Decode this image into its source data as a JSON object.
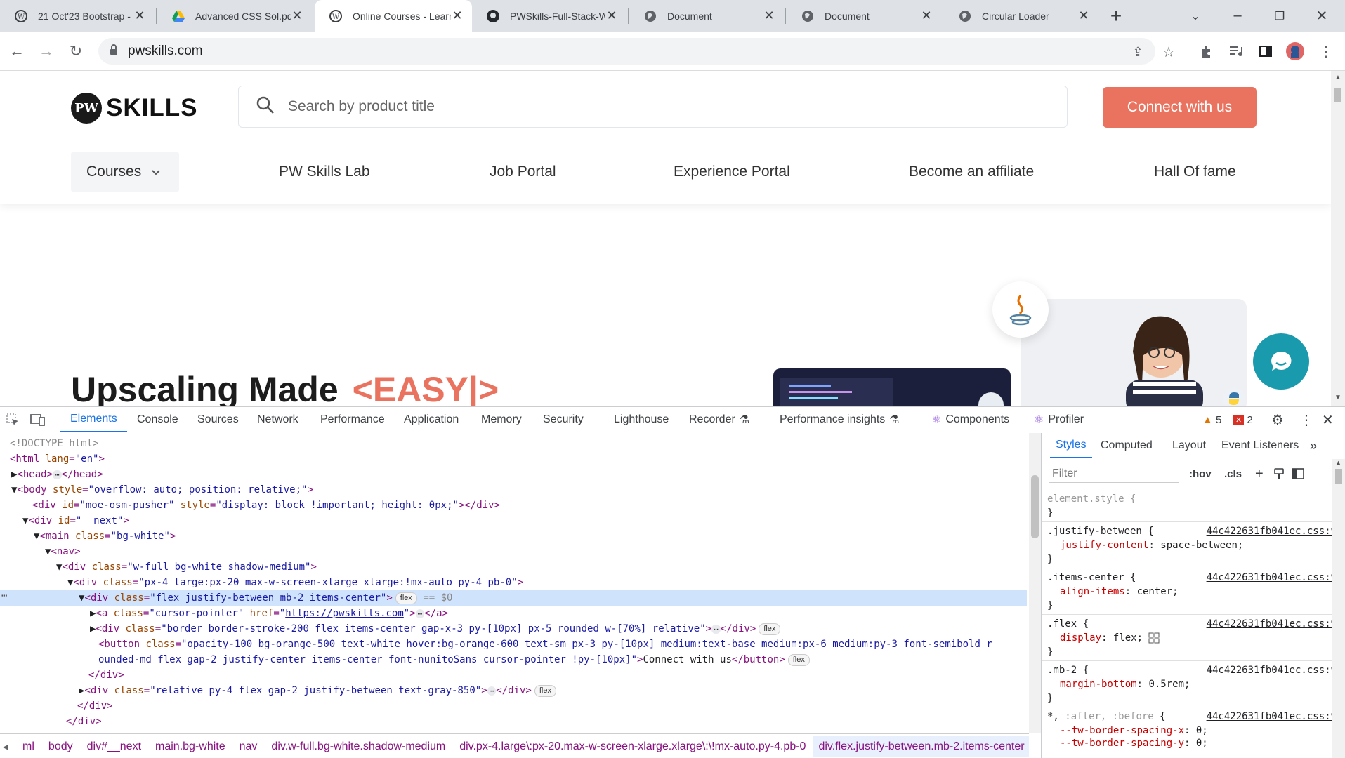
{
  "browser": {
    "tabs": [
      {
        "title": "21 Oct'23 Bootstrap -",
        "icon": "wordpress-icon"
      },
      {
        "title": "Advanced CSS Sol.pdf",
        "icon": "google-drive-icon"
      },
      {
        "title": "Online Courses - Learn",
        "icon": "wordpress-icon",
        "active": true
      },
      {
        "title": "PWSkills-Full-Stack-We",
        "icon": "github-icon"
      },
      {
        "title": "Document",
        "icon": "globe-icon"
      },
      {
        "title": "Document",
        "icon": "globe-icon"
      },
      {
        "title": "Circular Loader",
        "icon": "globe-icon"
      }
    ],
    "url": "pwskills.com"
  },
  "site": {
    "logo_text": "SKILLS",
    "logo_badge": "PW",
    "search_placeholder": "Search by product title",
    "connect_label": "Connect with us",
    "nav": [
      "Courses",
      "PW Skills Lab",
      "Job Portal",
      "Experience Portal",
      "Become an affiliate",
      "Hall Of fame"
    ],
    "hero_title": "Upscaling Made",
    "hero_highlight": "<EASY|>"
  },
  "devtools": {
    "tabs": [
      "Elements",
      "Console",
      "Sources",
      "Network",
      "Performance",
      "Application",
      "Memory",
      "Security",
      "Lighthouse",
      "Recorder",
      "Performance insights",
      "Components",
      "Profiler"
    ],
    "warnings": "5",
    "errors": "2",
    "breadcrumbs": [
      "ml",
      "body",
      "div#__next",
      "main.bg-white",
      "nav",
      "div.w-full.bg-white.shadow-medium",
      "div.px-4.large\\:px-20.max-w-screen-xlarge.xlarge\\:\\!mx-auto.py-4.pb-0",
      "div.flex.justify-between.mb-2.items-center"
    ],
    "sidebar_tabs": [
      "Styles",
      "Computed",
      "Layout",
      "Event Listeners"
    ],
    "filter_placeholder": "Filter",
    "hov": ":hov",
    "cls": ".cls",
    "source_file": "44c422631fb041ec.css:9"
  }
}
